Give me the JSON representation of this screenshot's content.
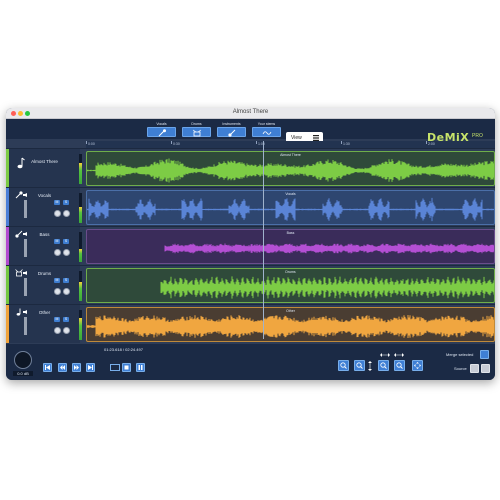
{
  "window": {
    "title": "Almost There"
  },
  "toolbar": {
    "sources": [
      {
        "label": "Vocals",
        "icon": "microphone-icon"
      },
      {
        "label": "Drums",
        "icon": "drums-icon"
      },
      {
        "label": "Instruments",
        "icon": "guitar-icon"
      },
      {
        "label": "Your stems",
        "icon": "stems-icon"
      }
    ],
    "view_label": "View",
    "logo": "DeMiX",
    "logo_sub": "PRO"
  },
  "ruler": {
    "ticks": [
      "0:00",
      "0:30",
      "1:00",
      "1:30",
      "2:00"
    ]
  },
  "tracks": [
    {
      "name": "Almost There",
      "lane_label": "Almost There",
      "icon": "music-note-icon",
      "color": "#7dcc45",
      "wave": "#7dcc45",
      "bg": "#2f4a3a"
    },
    {
      "name": "Vocals",
      "lane_label": "Vocals",
      "icon": "microphone-icon",
      "color": "#4b7fd8",
      "wave": "#5a84d6",
      "bg": "#2e4670",
      "mute": "M",
      "solo": "S"
    },
    {
      "name": "Bass",
      "lane_label": "Bass",
      "icon": "guitar-icon",
      "color": "#b24ad0",
      "wave": "#b44fd4",
      "bg": "#3a2c5a",
      "mute": "M",
      "solo": "S"
    },
    {
      "name": "Drums",
      "lane_label": "Drums",
      "icon": "drums-icon",
      "color": "#74c83f",
      "wave": "#7dcc45",
      "bg": "#2f4a3a",
      "mute": "M",
      "solo": "S"
    },
    {
      "name": "Other",
      "lane_label": "Other",
      "icon": "music-note-icon",
      "color": "#f1a33a",
      "wave": "#f0a640",
      "bg": "#4a3d32",
      "mute": "M",
      "solo": "S"
    }
  ],
  "transport": {
    "gain": "0.0 dB",
    "time": "01:23.618 / 02:24.497"
  },
  "side": {
    "merge_label": "Merge selected",
    "source_label": "Source"
  }
}
